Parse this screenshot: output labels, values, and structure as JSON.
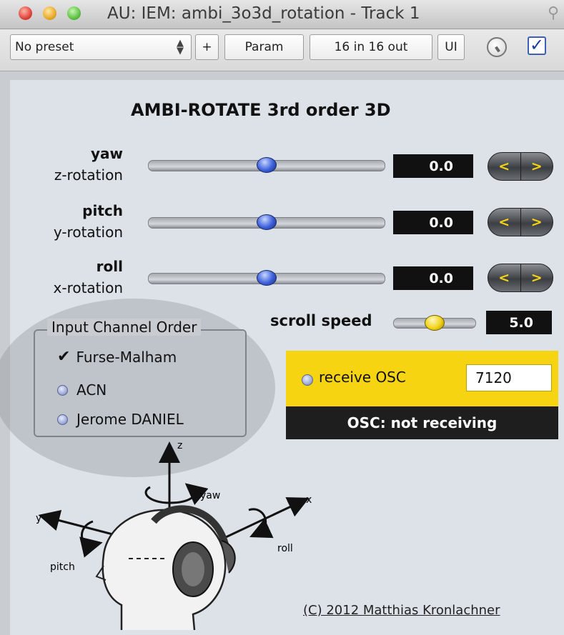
{
  "window": {
    "title": "AU: IEM: ambi_3o3d_rotation - Track 1"
  },
  "toolbar": {
    "preset": "No preset",
    "plus": "+",
    "param": "Param",
    "io": "16 in 16 out",
    "ui": "UI"
  },
  "plugin": {
    "title": "AMBI-ROTATE 3rd order 3D",
    "rotations": [
      {
        "name": "yaw",
        "axis": "z-rotation",
        "value": "0.0",
        "position": 0.5
      },
      {
        "name": "pitch",
        "axis": "y-rotation",
        "value": "0.0",
        "position": 0.5
      },
      {
        "name": "roll",
        "axis": "x-rotation",
        "value": "0.0",
        "position": 0.5
      }
    ],
    "stepper": {
      "left": "<",
      "right": ">"
    },
    "scroll_speed": {
      "label": "scroll speed",
      "value": "5.0",
      "position": 0.5
    },
    "input_order": {
      "title": "Input Channel Order",
      "options": [
        {
          "label": "Furse-Malham",
          "selected": true
        },
        {
          "label": "ACN",
          "selected": false
        },
        {
          "label": "Jerome DANIEL",
          "selected": false
        }
      ]
    },
    "osc": {
      "receive_label": "receive OSC",
      "port": "7120",
      "status": "OSC: not receiving"
    },
    "diagram": {
      "z": "z",
      "y": "y",
      "x": "x",
      "yaw": "yaw",
      "pitch": "pitch",
      "roll": "roll"
    },
    "copyright": "(C) 2012 Matthias Kronlachner"
  },
  "colors": {
    "accent_yellow": "#f6d411",
    "slider_blue": "#3b5fd9",
    "value_box": "#111111"
  }
}
